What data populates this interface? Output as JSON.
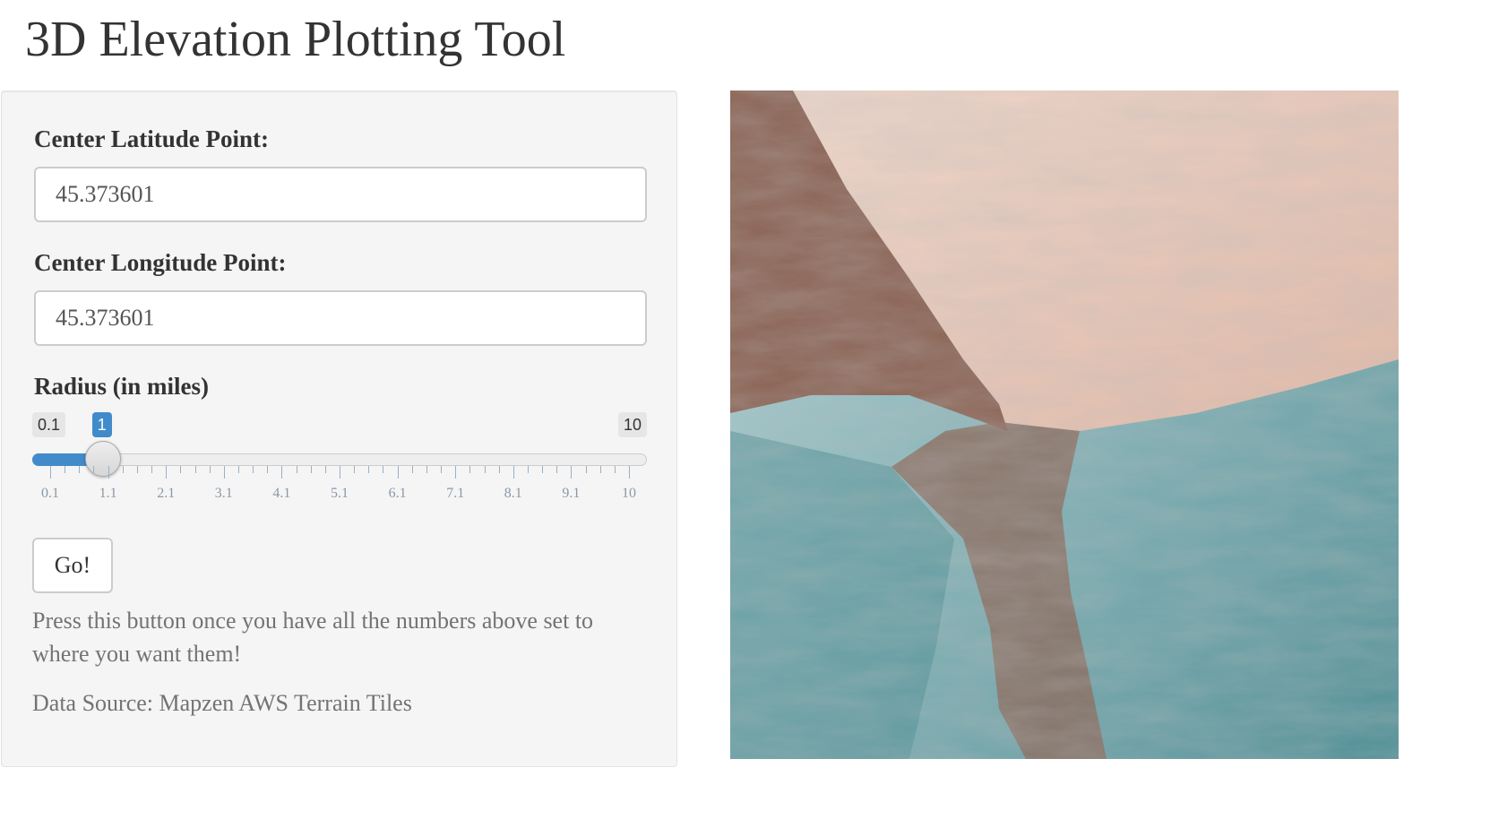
{
  "app": {
    "title": "3D Elevation Plotting Tool"
  },
  "sidebar": {
    "latitude": {
      "label": "Center Latitude Point:",
      "value": "45.373601"
    },
    "longitude": {
      "label": "Center Longitude Point:",
      "value": "45.373601"
    },
    "radius": {
      "label": "Radius (in miles)",
      "min_label": "0.1",
      "max_label": "10",
      "value_label": "1",
      "min": 0.1,
      "max": 10,
      "value": 1,
      "tick_labels": [
        "0.1",
        "1.1",
        "2.1",
        "3.1",
        "4.1",
        "5.1",
        "6.1",
        "7.1",
        "8.1",
        "9.1",
        "10"
      ]
    },
    "go_button_label": "Go!",
    "help_text": "Press this button once you have all the numbers above set to where you want them!",
    "source_text": "Data Source: Mapzen AWS Terrain Tiles"
  },
  "plot": {
    "colors": {
      "warm_dark": "#8a6152",
      "warm_light": "#e3b9a6",
      "cool_dark": "#4e8f96",
      "cool_light": "#b8d6d8",
      "pale": "#efd7cb"
    }
  },
  "theme": {
    "accent": "#428bca",
    "panel_bg": "#f5f5f5"
  }
}
